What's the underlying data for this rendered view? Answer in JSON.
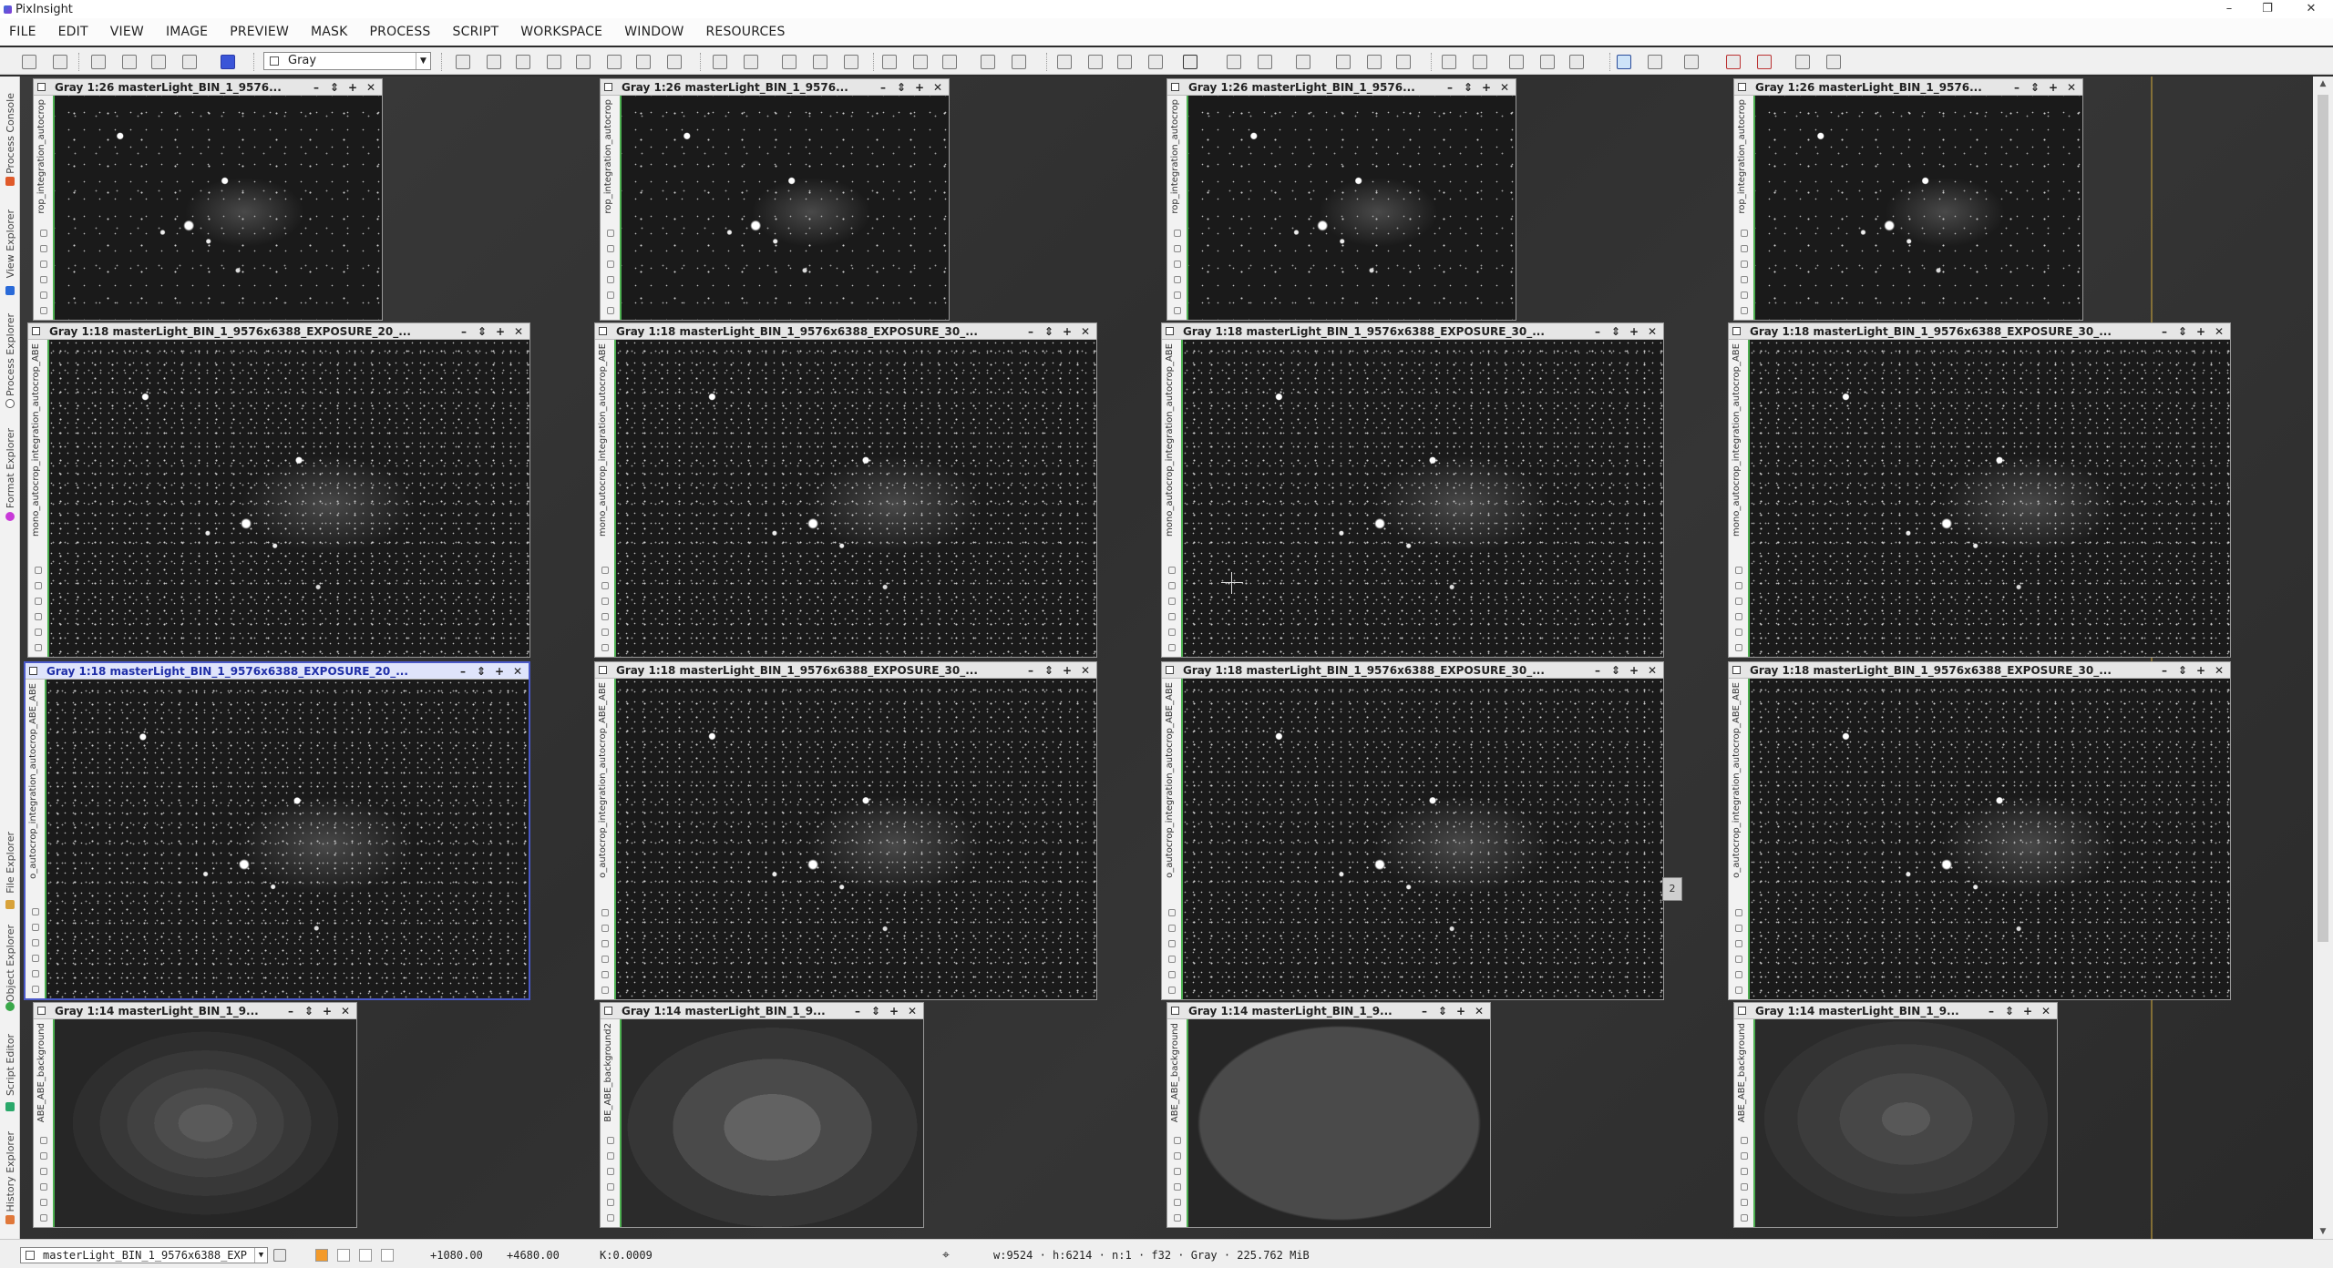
{
  "window": {
    "title": "PixInsight",
    "controls": [
      "–",
      "❐",
      "✕"
    ]
  },
  "menu": [
    "FILE",
    "EDIT",
    "VIEW",
    "IMAGE",
    "PREVIEW",
    "MASK",
    "PROCESS",
    "SCRIPT",
    "WORKSPACE",
    "WINDOW",
    "RESOURCES"
  ],
  "toolbar": {
    "view_select": "Gray"
  },
  "sidebar": {
    "tabs": [
      "Process Console",
      "View Explorer",
      "Process Explorer",
      "Format Explorer",
      "File Explorer",
      "Object Explorer",
      "Script Editor",
      "History Explorer"
    ]
  },
  "image_windows": [
    {
      "title": "Gray 1:26 masterLight_BIN_1_9576...",
      "side_label": "rop_integration_autocrop",
      "content": "stars",
      "active": false
    },
    {
      "title": "Gray 1:26 masterLight_BIN_1_9576...",
      "side_label": "rop_integration_autocrop",
      "content": "stars",
      "active": false
    },
    {
      "title": "Gray 1:26 masterLight_BIN_1_9576...",
      "side_label": "rop_integration_autocrop",
      "content": "stars",
      "active": false
    },
    {
      "title": "Gray 1:26 masterLight_BIN_1_9576...",
      "side_label": "rop_integration_autocrop",
      "content": "stars",
      "active": false
    },
    {
      "title": "Gray 1:18 masterLight_BIN_1_9576x6388_EXPOSURE_20_...",
      "side_label": "mono_autocrop_integration_autocrop_ABE",
      "content": "stars",
      "active": false
    },
    {
      "title": "Gray 1:18 masterLight_BIN_1_9576x6388_EXPOSURE_30_...",
      "side_label": "mono_autocrop_integration_autocrop_ABE",
      "content": "stars",
      "active": false
    },
    {
      "title": "Gray 1:18 masterLight_BIN_1_9576x6388_EXPOSURE_30_...",
      "side_label": "mono_autocrop_integration_autocrop_ABE",
      "content": "stars",
      "active": false
    },
    {
      "title": "Gray 1:18 masterLight_BIN_1_9576x6388_EXPOSURE_30_...",
      "side_label": "mono_autocrop_integration_autocrop_ABE",
      "content": "stars",
      "active": false
    },
    {
      "title": "Gray 1:18 masterLight_BIN_1_9576x6388_EXPOSURE_20_...",
      "side_label": "o_autocrop_integration_autocrop_ABE_ABE",
      "content": "stars",
      "active": true
    },
    {
      "title": "Gray 1:18 masterLight_BIN_1_9576x6388_EXPOSURE_30_...",
      "side_label": "o_autocrop_integration_autocrop_ABE_ABE",
      "content": "stars",
      "active": false
    },
    {
      "title": "Gray 1:18 masterLight_BIN_1_9576x6388_EXPOSURE_30_...",
      "side_label": "o_autocrop_integration_autocrop_ABE_ABE",
      "content": "stars",
      "active": false
    },
    {
      "title": "Gray 1:18 masterLight_BIN_1_9576x6388_EXPOSURE_30_...",
      "side_label": "o_autocrop_integration_autocrop_ABE_ABE",
      "content": "stars",
      "active": false
    },
    {
      "title": "Gray 1:14 masterLight_BIN_1_9...",
      "side_label": "ABE_ABE_background",
      "content": "bgA",
      "active": false
    },
    {
      "title": "Gray 1:14 masterLight_BIN_1_9...",
      "side_label": "BE_ABE_background2",
      "content": "bgB",
      "active": false
    },
    {
      "title": "Gray 1:14 masterLight_BIN_1_9...",
      "side_label": "ABE_ABE_background",
      "content": "bgC",
      "active": false
    },
    {
      "title": "Gray 1:14 masterLight_BIN_1_9...",
      "side_label": "ABE_ABE_background",
      "content": "bgD",
      "active": false
    }
  ],
  "window_buttons": [
    "–",
    "⇕",
    "+",
    "✕"
  ],
  "shade_tab_label": "2",
  "statusbar": {
    "view": "masterLight_BIN_1_9576x6388_EXP",
    "coord_x": "+1080.00",
    "coord_y": "+4680.00",
    "value": "K:0.0009",
    "info": "w:9524 · h:6214 · n:1 · f32 · Gray · 225.762 MiB"
  },
  "colors": {
    "active_frame": "#4a59c8",
    "channel_bar": "#4caf50",
    "workspace": "#2d2d2d"
  }
}
